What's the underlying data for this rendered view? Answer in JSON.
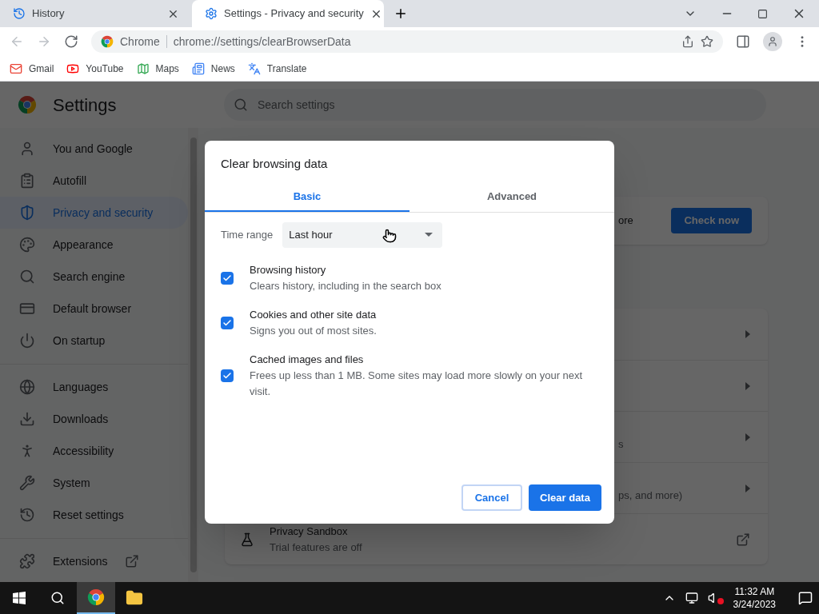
{
  "browser": {
    "tabs": [
      {
        "title": "History",
        "selected": false
      },
      {
        "title": "Settings - Privacy and security",
        "selected": true
      }
    ],
    "site_label": "Chrome",
    "url": "chrome://settings/clearBrowserData",
    "bookmarks": [
      "Gmail",
      "YouTube",
      "Maps",
      "News",
      "Translate"
    ]
  },
  "settings": {
    "title": "Settings",
    "search_placeholder": "Search settings",
    "nav_groups": [
      [
        {
          "label": "You and Google",
          "selected": false
        },
        {
          "label": "Autofill",
          "selected": false
        },
        {
          "label": "Privacy and security",
          "selected": true
        },
        {
          "label": "Appearance",
          "selected": false
        },
        {
          "label": "Search engine",
          "selected": false
        },
        {
          "label": "Default browser",
          "selected": false
        },
        {
          "label": "On startup",
          "selected": false
        }
      ],
      [
        {
          "label": "Languages",
          "selected": false
        },
        {
          "label": "Downloads",
          "selected": false
        },
        {
          "label": "Accessibility",
          "selected": false
        },
        {
          "label": "System",
          "selected": false
        },
        {
          "label": "Reset settings",
          "selected": false
        }
      ],
      [
        {
          "label": "Extensions",
          "selected": false
        }
      ]
    ],
    "safety_check": {
      "text": "ore",
      "button": "Check now"
    },
    "rows": [
      {
        "kind": "submenu"
      },
      {
        "kind": "submenu"
      },
      {
        "kind": "submenu",
        "text": "s"
      },
      {
        "kind": "submenu",
        "text": "ps, and more)"
      },
      {
        "kind": "external",
        "title": "Privacy Sandbox",
        "subtitle": "Trial features are off"
      }
    ]
  },
  "dialog": {
    "title": "Clear browsing data",
    "tabs": [
      {
        "label": "Basic",
        "selected": true
      },
      {
        "label": "Advanced",
        "selected": false
      }
    ],
    "time_range": {
      "label": "Time range",
      "value": "Last hour"
    },
    "options": [
      {
        "title": "Browsing history",
        "description": "Clears history, including in the search box",
        "checked": true
      },
      {
        "title": "Cookies and other site data",
        "description": "Signs you out of most sites.",
        "checked": true
      },
      {
        "title": "Cached images and files",
        "description": "Frees up less than 1 MB. Some sites may load more slowly on your next visit.",
        "checked": true
      }
    ],
    "buttons": {
      "cancel": "Cancel",
      "confirm": "Clear data"
    }
  },
  "taskbar": {
    "time": "11:32 AM",
    "date": "3/24/2023",
    "muted": true
  }
}
